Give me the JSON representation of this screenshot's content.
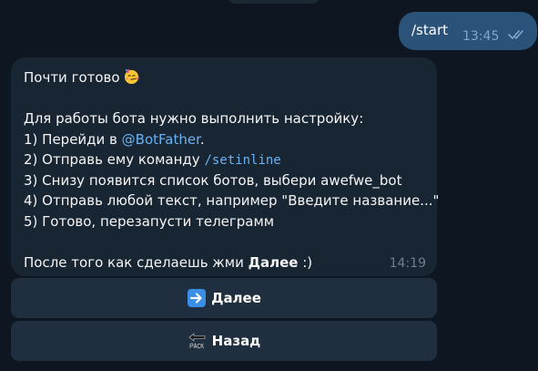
{
  "outgoing": {
    "text": "/start",
    "time": "13:45",
    "status_icon": "double-check-icon"
  },
  "incoming": {
    "line1": "Почти готово",
    "line1_emoji": "partying-face",
    "line3": "Для работы бота нужно выполнить настройку:",
    "line4_prefix": "1) Перейди в ",
    "line4_link": "@BotFather",
    "line4_suffix": ".",
    "line5_prefix": "2) Отправь ему команду ",
    "line5_code": "/setinline",
    "line6": "3) Снизу появится список ботов, выбери awefwe_bot",
    "line7": "4) Отправь любой текст, например \"Введите название...\"",
    "line8": "5) Готово, перезапусти телеграмм",
    "line10_prefix": "После того как сделаешь жми ",
    "line10_bold": "Далее",
    "line10_suffix": " :)",
    "time": "14:19"
  },
  "keyboard": {
    "next_icon": "right-arrow-icon",
    "next_label": "Далее",
    "back_icon": "back-arrow-icon",
    "back_label": "Назад"
  },
  "colors": {
    "background": "#0e1621",
    "outgoing_bubble": "#2b5278",
    "incoming_bubble": "#182533",
    "keyboard_button": "#1f2f3f",
    "link": "#6ab2f2"
  }
}
